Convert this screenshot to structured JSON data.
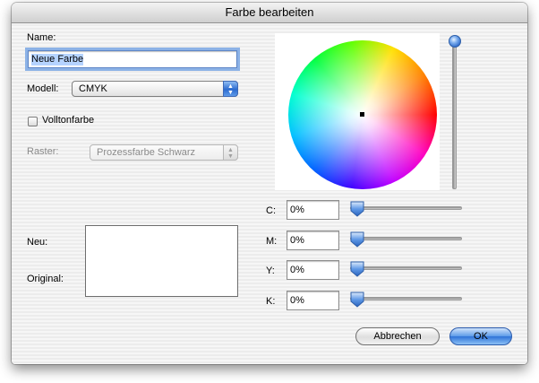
{
  "window": {
    "title": "Farbe bearbeiten"
  },
  "name_section": {
    "label": "Name:",
    "value": "Neue Farbe"
  },
  "modell": {
    "label": "Modell:",
    "selected": "CMYK"
  },
  "volltonfarbe": {
    "label": "Volltonfarbe",
    "checked": false
  },
  "raster": {
    "label": "Raster:",
    "selected": "Prozessfarbe Schwarz",
    "disabled": true
  },
  "preview": {
    "new_label": "Neu:",
    "original_label": "Original:",
    "new_color": "#ffffff",
    "original_color": "#ffffff"
  },
  "channels": [
    {
      "label": "C:",
      "value": "0%",
      "fraction": 0
    },
    {
      "label": "M:",
      "value": "0%",
      "fraction": 0
    },
    {
      "label": "Y:",
      "value": "0%",
      "fraction": 0
    },
    {
      "label": "K:",
      "value": "0%",
      "fraction": 0
    }
  ],
  "brightness_slider": {
    "fraction": 1
  },
  "buttons": {
    "cancel": "Abbrechen",
    "ok": "OK"
  },
  "icons": {
    "popup_arrows": "up-down-arrows-icon",
    "check": "checkbox-icon"
  },
  "colors": {
    "accent": "#2f73d8",
    "focus": "#8cb2e6"
  }
}
